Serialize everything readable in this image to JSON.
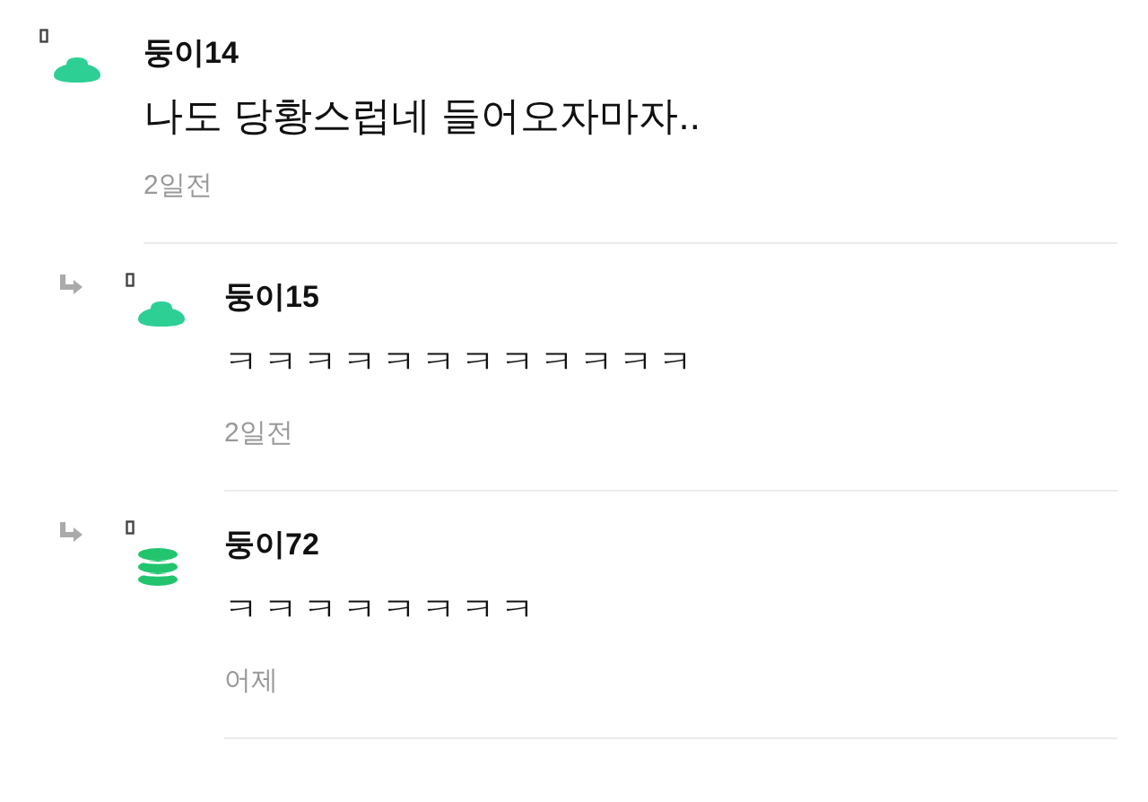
{
  "comments": [
    {
      "kind": "comment",
      "author": "둥이14",
      "avatar": {
        "kind": "blob",
        "color": "#2dcf95"
      },
      "text": "나도 당황스럽네 들어오자마자..",
      "time": "2일전"
    },
    {
      "kind": "reply",
      "author": "둥이15",
      "avatar": {
        "kind": "blob",
        "color": "#2dcf95"
      },
      "text": "ㅋㅋㅋㅋㅋㅋㅋㅋㅋㅋㅋㅋ",
      "time": "2일전"
    },
    {
      "kind": "reply",
      "author": "둥이72",
      "avatar": {
        "kind": "stack",
        "color": "#22c46e"
      },
      "text": "ㅋㅋㅋㅋㅋㅋㅋㅋ",
      "time": "어제"
    }
  ]
}
